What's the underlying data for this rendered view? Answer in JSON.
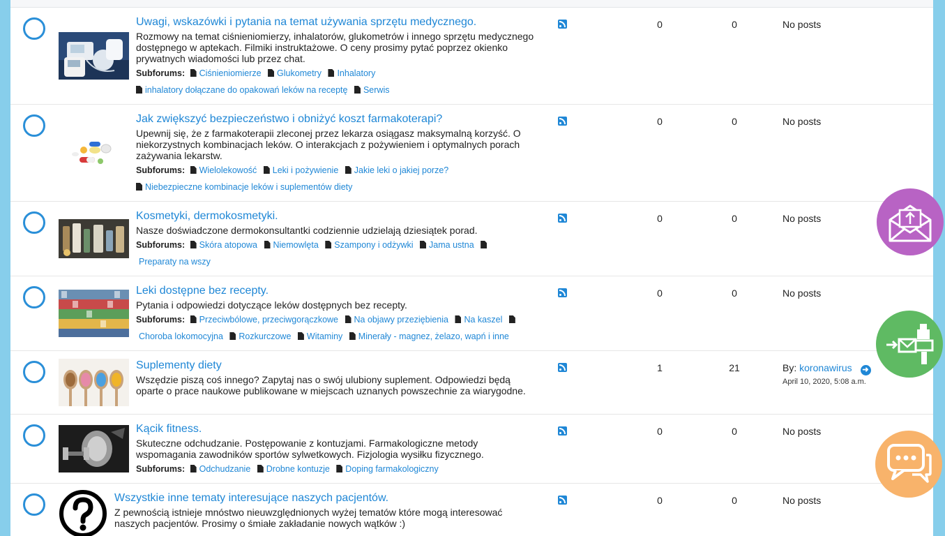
{
  "forums": [
    {
      "title": "Uwagi, wskazówki i pytania na temat używania sprzętu medycznego.",
      "description": "Rozmowy na temat ciśnieniomierzy, inhalatorów, glukometrów i innego sprzętu medycznego dostępnego w aptekach. Filmiki instruktażowe. O ceny prosimy pytać poprzez okienko prywatnych wiadomości lub przez chat.",
      "subforums_label": "Subforums:",
      "subforums": [
        "Ciśnieniomierze",
        "Glukometry",
        "Inhalatory",
        "inhalatory dołączane do opakowań leków na receptę",
        "Serwis"
      ],
      "topics": "0",
      "posts": "0",
      "last_post": "No posts",
      "thumb_icon": "medical-devices-image"
    },
    {
      "title": "Jak zwiększyć bezpieczeństwo i obniżyć koszt farmakoterapi?",
      "description": "Upewnij się, że z farmakoterapii zleconej przez lekarza osiągasz maksymalną korzyść. O niekorzystnych kombinacjach leków. O interakcjach z pożywieniem i optymalnych porach zażywania lekarstw.",
      "subforums_label": "Subforums:",
      "subforums": [
        "Wielolekowość",
        "Leki i pożywienie",
        "Jakie leki o jakiej porze?",
        "Niebezpieczne kombinacje leków i suplementów diety"
      ],
      "topics": "0",
      "posts": "0",
      "last_post": "No posts",
      "thumb_icon": "pills-image"
    },
    {
      "title": "Kosmetyki, dermokosmetyki.",
      "description": "Nasze doświadczone dermokonsultantki codziennie udzielają dziesiątek porad.",
      "subforums_label": "Subforums:",
      "subforums": [
        "Skóra atopowa",
        "Niemowlęta",
        "Szampony i odżywki",
        "Jama ustna",
        "",
        "Preparaty na wszy"
      ],
      "topics": "0",
      "posts": "0",
      "last_post": "No posts",
      "thumb_icon": "cosmetics-image"
    },
    {
      "title": "Leki dostępne bez recepty.",
      "description": "Pytania i odpowiedzi dotyczące leków dostępnych bez recepty.",
      "subforums_label": "Subforums:",
      "subforums": [
        "Przeciwbólowe, przeciwgorączkowe",
        "Na objawy przeziębienia",
        "Na kaszel",
        "",
        "Choroba lokomocyjna",
        "Rozkurczowe",
        "Witaminy",
        "Minerały - magnez, żelazo, wapń i inne"
      ],
      "topics": "0",
      "posts": "0",
      "last_post": "No posts",
      "thumb_icon": "pharmacy-shelves-image"
    },
    {
      "title": "Suplementy diety",
      "description": "Wszędzie piszą coś innego? Zapytaj nas o swój ulubiony suplement. Odpowiedzi będą oparte o prace naukowe publikowane w miejscach uznanych powszechnie za wiarygodne.",
      "subforums_label": "",
      "subforums": [],
      "topics": "1",
      "posts": "21",
      "last_post": "",
      "last_by_prefix": "By:",
      "last_by_user": "koronawirus",
      "last_date": "April 10, 2020, 5:08 a.m.",
      "thumb_icon": "supplement-spoons-image"
    },
    {
      "title": "Kącik fitness.",
      "description": "Skuteczne odchudzanie. Postępowanie z kontuzjami. Farmakologiczne metody wspomagania zawodników sportów sylwetkowych. Fizjologia wysiłku fizycznego.",
      "subforums_label": "Subforums:",
      "subforums": [
        "Odchudzanie",
        "Drobne kontuzje",
        "Doping farmakologiczny"
      ],
      "topics": "0",
      "posts": "0",
      "last_post": "No posts",
      "thumb_icon": "fitness-image"
    },
    {
      "title": "Wszystkie inne tematy interesujące naszych pacjentów.",
      "description": "Z pewnością istnieje mnóstwo nieuwzględnionych wyżej tematów które mogą interesować naszych pacjentów. Prosimy o śmiałe zakładanie nowych wątków :)",
      "subforums_label": "",
      "subforums": [],
      "topics": "0",
      "posts": "0",
      "last_post": "No posts",
      "thumb_icon": "question-mark-icon"
    }
  ],
  "icons": {
    "status": "forum-read-circle-icon",
    "rss": "rss-feed-icon",
    "subforum": "document-icon",
    "goto": "arrow-right-circle-icon"
  },
  "floating_buttons": [
    {
      "name": "envelope-upload-icon",
      "color": "#b863c4"
    },
    {
      "name": "send-mail-icon",
      "color": "#5fba63"
    },
    {
      "name": "chat-bubbles-icon",
      "color": "#f8b36b"
    }
  ],
  "colors": {
    "background": "#87ceeb",
    "link": "#1f87d6",
    "text": "#222222"
  }
}
